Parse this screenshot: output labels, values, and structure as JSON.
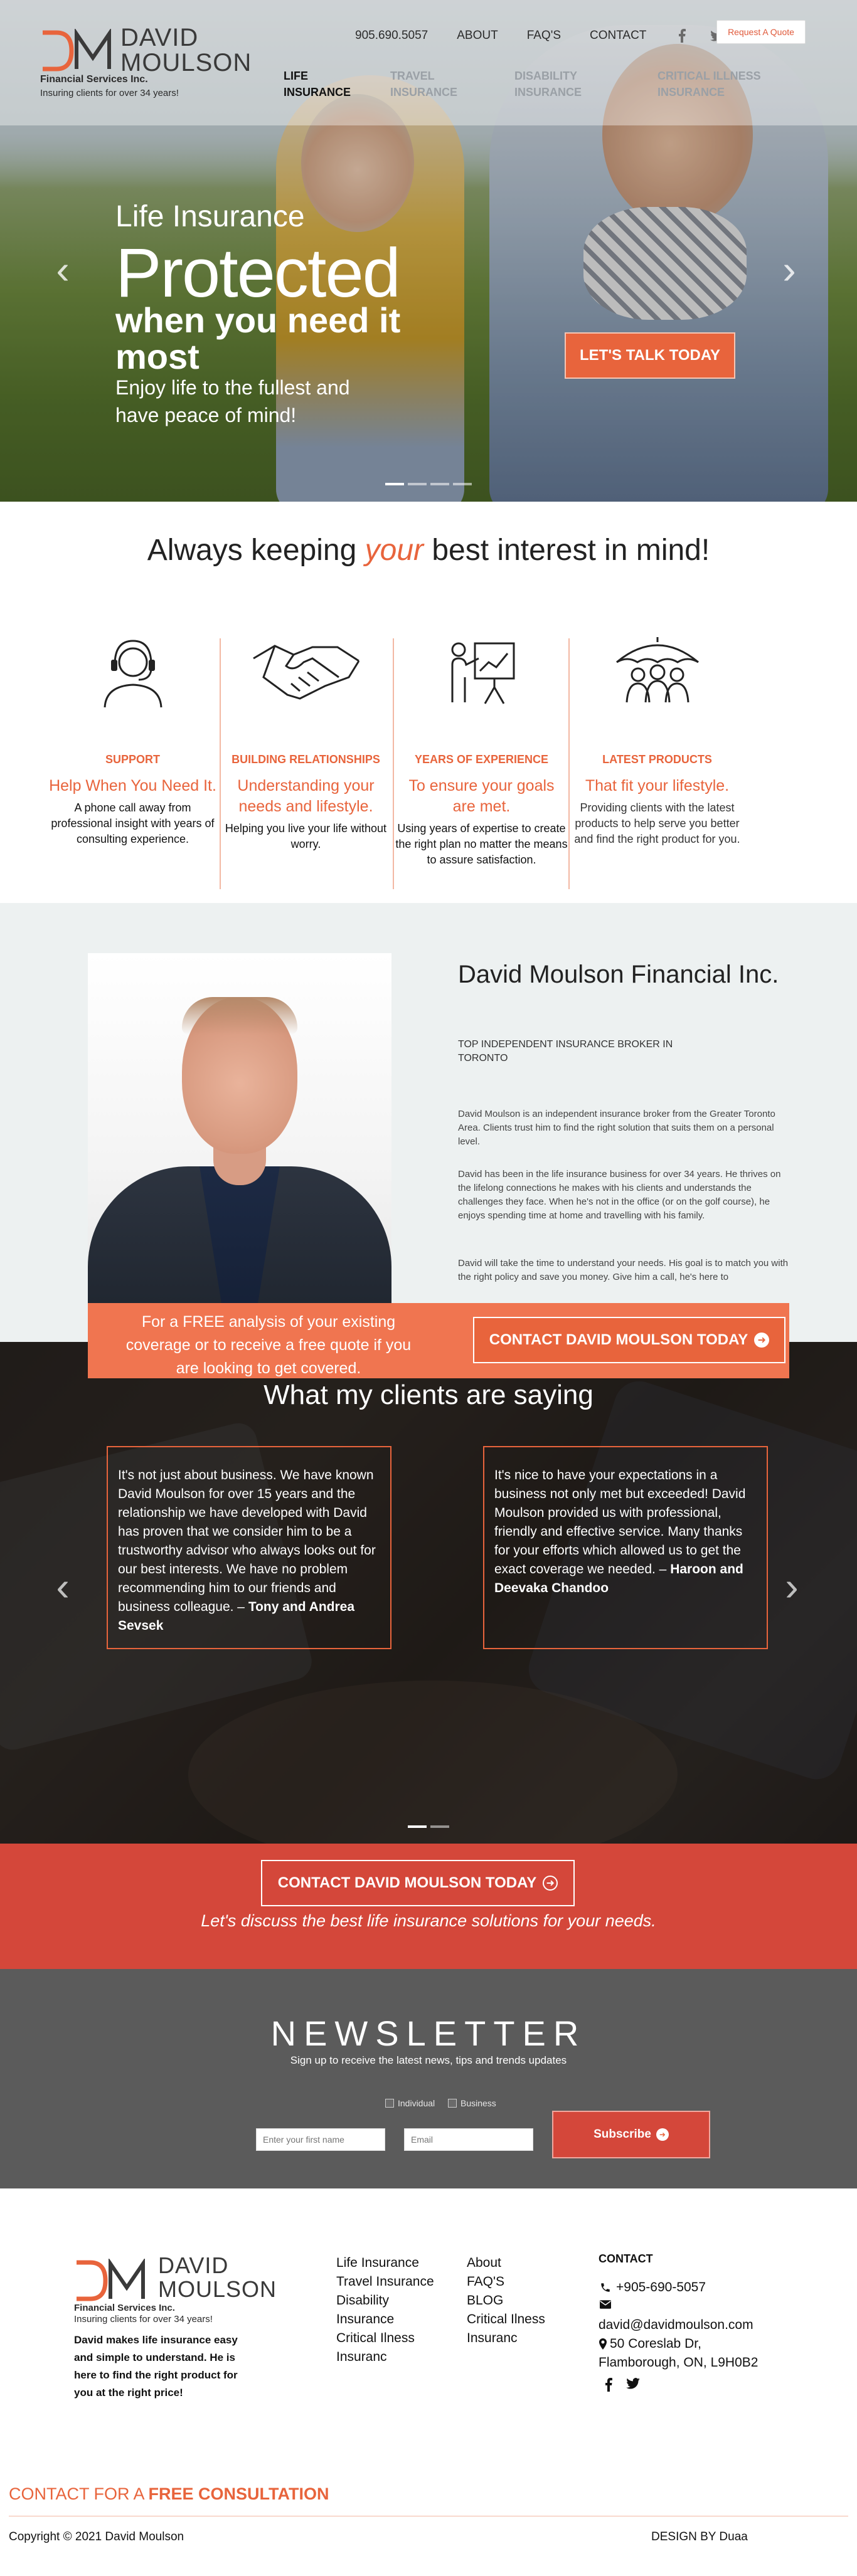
{
  "brand": {
    "name_line1": "DAVID",
    "name_line2": "MOULSON",
    "subtitle": "Financial Services Inc.",
    "tagline": "Insuring clients for over 34 years!",
    "colors": {
      "accent": "#e8643c",
      "red": "#d4473a",
      "dark": "#222222"
    }
  },
  "topnav": {
    "phone": "905.690.5057",
    "items": [
      "ABOUT",
      "FAQ'S",
      "CONTACT"
    ],
    "quote_button": "Request A Quote",
    "icons": [
      "facebook-icon",
      "twitter-icon"
    ]
  },
  "mainnav": {
    "items": [
      {
        "line1": "LIFE",
        "line2": "INSURANCE",
        "active": true
      },
      {
        "line1": "TRAVEL",
        "line2": "INSURANCE",
        "active": false
      },
      {
        "line1": "DISABILITY",
        "line2": "INSURANCE",
        "active": false
      },
      {
        "line1": "CRITICAL ILLNESS",
        "line2": "INSURANCE",
        "active": false
      }
    ]
  },
  "hero": {
    "small": "Life Insurance",
    "big": "Protected",
    "bold": "when you need it most",
    "sub": "Enjoy life to the fullest and have peace of mind!",
    "cta": "LET'S TALK TODAY",
    "slides": 4,
    "active_slide": 0
  },
  "tagline": {
    "before": "Always keeping ",
    "emph": "your",
    "after": " best interest in mind!"
  },
  "features": [
    {
      "icon": "headset-support-icon",
      "title": "SUPPORT",
      "sub": "Help When You Need It.",
      "desc": "A phone call away from professional insight with years of consulting experience."
    },
    {
      "icon": "handshake-icon",
      "title": "BUILDING RELATIONSHIPS",
      "sub": "Understanding your needs and lifestyle.",
      "desc": "Helping you live your life without worry."
    },
    {
      "icon": "presentation-easel-icon",
      "title": "YEARS OF EXPERIENCE",
      "sub": "To ensure your goals are met.",
      "desc": "Using years of expertise to create the right plan no matter the means to assure satisfaction."
    },
    {
      "icon": "umbrella-family-icon",
      "title": "LATEST PRODUCTS",
      "sub": "That fit your lifestyle.",
      "desc": "Providing clients with the latest products to help serve you better and find the right product for you."
    }
  ],
  "about": {
    "title": "David Moulson Financial Inc.",
    "kicker": "TOP INDEPENDENT INSURANCE BROKER IN TORONTO",
    "paragraphs": [
      "David Moulson is an independent insurance broker from the Greater Toronto Area. Clients trust him to find the right solution that suits them on a personal level.",
      "David has been in the life insurance business for over 34 years. He thrives on the lifelong connections he makes with his clients and understands the challenges they face. When he's not in the office (or on the golf course), he enjoys spending time at home and travelling with his family.",
      "David will take the time to understand your needs. His goal is to match you with the right policy and save you money. Give him a call, he's here to"
    ],
    "cta_text": "For a FREE analysis of your existing coverage or to receive a free quote if you are looking to get covered.",
    "cta_button": "CONTACT DAVID MOULSON TODAY"
  },
  "testimonials": {
    "title": "What my clients are saying",
    "items": [
      {
        "text": "It's not just about business. We have known David Moulson for over 15 years and the relationship we have developed with David has proven that we consider him to be a trustworthy advisor who always looks out for our best interests. We have no problem recommending him to our friends and business colleague. –",
        "author": "Tony and Andrea Sevsek"
      },
      {
        "text": "It's nice to have your expectations in a business not only met but exceeded! David Moulson provided us with professional, friendly and effective service. Many thanks for your efforts which allowed us to get the exact coverage we needed. –",
        "author": "Haroon and Deevaka Chandoo"
      }
    ],
    "slides": 2,
    "active_slide": 0
  },
  "cta_band": {
    "button": "CONTACT DAVID MOULSON TODAY",
    "text": "Let's discuss the best life insurance solutions for your needs."
  },
  "newsletter": {
    "title": "NEWSLETTER",
    "sub": "Sign up to receive the latest news, tips and trends updates",
    "options": [
      "Individual",
      "Business"
    ],
    "first_name_placeholder": "Enter your first name",
    "email_placeholder": "Email",
    "button": "Subscribe"
  },
  "footer": {
    "desc": "David makes life insurance easy and simple to understand.  He is here to find the right product for you at the right price!",
    "col1": [
      "Life Insurance",
      "Travel Insurance",
      "Disability",
      "Insurance",
      "Critical Ilness",
      "Insuranc"
    ],
    "col2": [
      "About",
      "FAQ'S",
      "BLOG",
      "Critical Ilness",
      "Insuranc"
    ],
    "contact_title": "CONTACT",
    "phone": "+905-690-5057",
    "email": "david@davidmoulson.com",
    "address1": "50 Coreslab Dr,",
    "address2": "Flamborough, ON, L9H0B2",
    "consult_pre": "CONTACT FOR A ",
    "consult_bold": "FREE CONSULTATION",
    "copyright": "Copyright © 2021 David Moulson",
    "design": "DESIGN BY Duaa"
  }
}
